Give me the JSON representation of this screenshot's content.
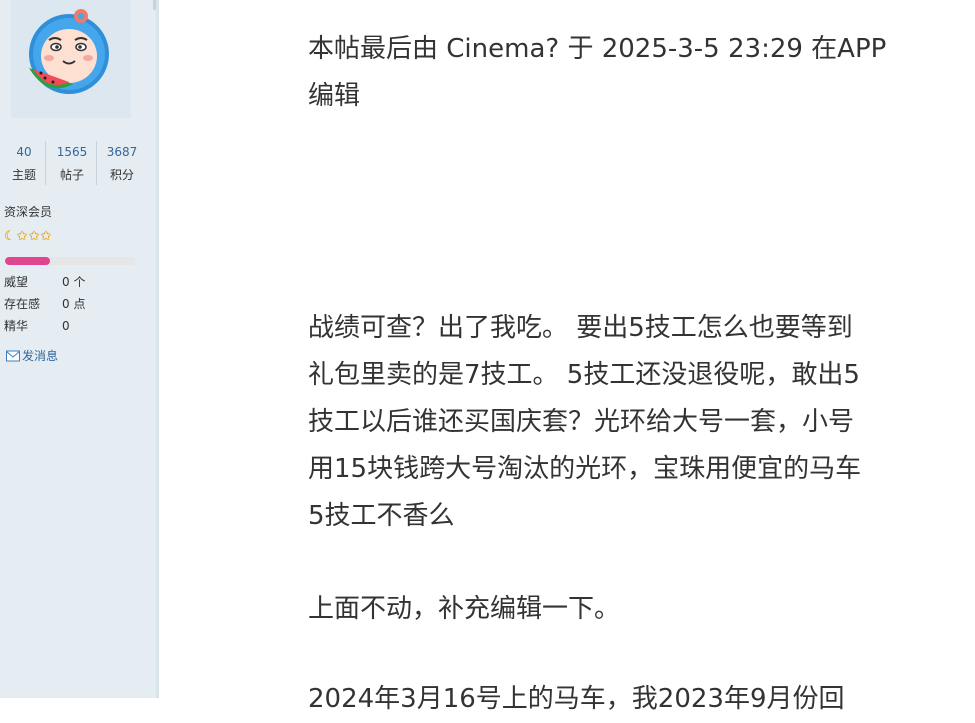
{
  "sidebar": {
    "avatar_alt": "watermelon-cartoon-avatar",
    "stats": [
      {
        "value": "40",
        "label": "主题"
      },
      {
        "value": "1565",
        "label": "帖子"
      },
      {
        "value": "3687",
        "label": "积分"
      }
    ],
    "user_group": "资深会员",
    "stars": [
      "☾",
      "✩",
      "✩",
      "✩"
    ],
    "level_progress_fraction": 0.34,
    "profile": [
      {
        "label": "威望",
        "value": "0 个"
      },
      {
        "label": "存在感",
        "value": "0 点"
      },
      {
        "label": "精华",
        "value": "0"
      }
    ],
    "send_message": "发消息"
  },
  "post": {
    "edit_note_line1": "本帖最后由 Cinema? 于 2025-3-5 23:29 在APP",
    "edit_note_line2": "编辑",
    "para1_lines": [
      "战绩可查？出了我吃。 要出5技工怎么也要等到",
      "礼包里卖的是7技工。 5技工还没退役呢，敢出5",
      "技工以后谁还买国庆套？光环给大号一套，小号",
      "用15块钱跨大号淘汰的光环，宝珠用便宜的马车",
      "5技工不香么"
    ],
    "para2": "上面不动，补充编辑一下。",
    "para3_partial": "2024年3月16号上的马车，我2023年9月份回"
  },
  "colors": {
    "sidebar_bg": "#e5edf2",
    "link": "#336699",
    "progress": "#e0458f",
    "text": "#333333"
  }
}
